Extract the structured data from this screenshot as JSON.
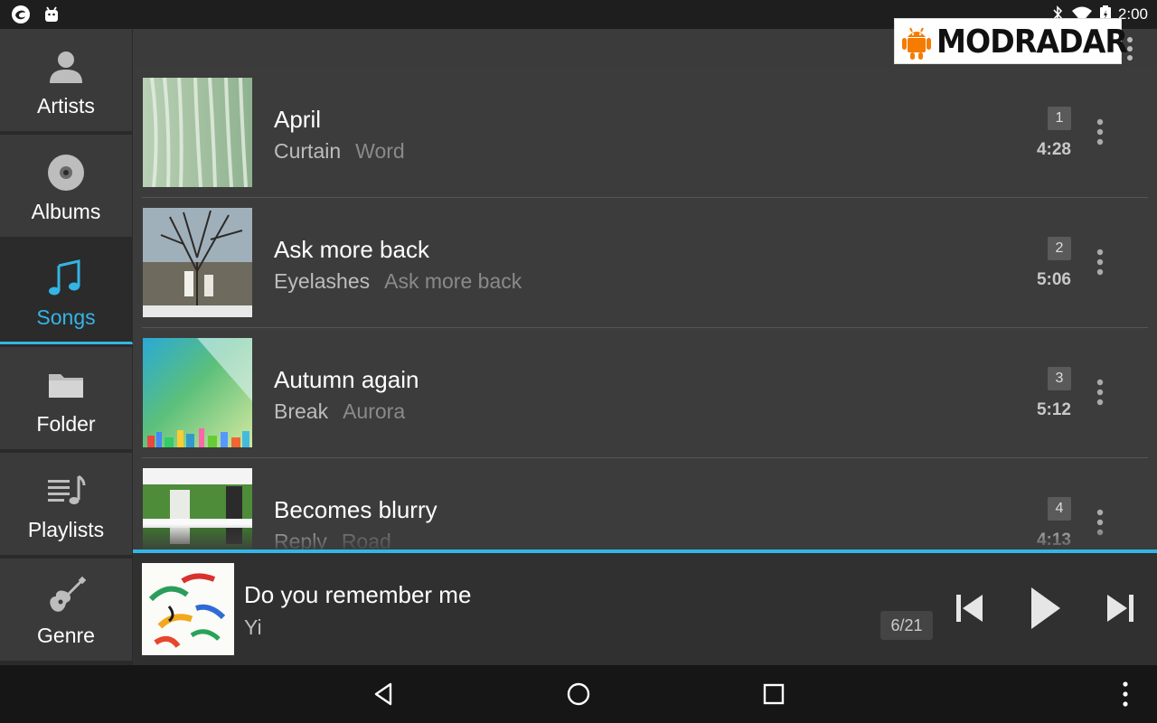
{
  "status_bar": {
    "time": "2:00",
    "left_icons": [
      "swirl-notification-icon",
      "android-notification-icon"
    ],
    "right_icons": [
      "bluetooth-icon",
      "wifi-icon",
      "battery-icon"
    ]
  },
  "watermark": {
    "text": "MODRADAR"
  },
  "sidebar": {
    "accent_color": "#33b5e5",
    "items": [
      {
        "label": "Artists",
        "icon": "person-icon",
        "active": false
      },
      {
        "label": "Albums",
        "icon": "disc-icon",
        "active": false
      },
      {
        "label": "Songs",
        "icon": "music-note-icon",
        "active": true
      },
      {
        "label": "Folder",
        "icon": "folder-icon",
        "active": false
      },
      {
        "label": "Playlists",
        "icon": "playlist-icon",
        "active": false
      },
      {
        "label": "Genre",
        "icon": "guitar-icon",
        "active": false
      }
    ]
  },
  "songs": [
    {
      "title": "April",
      "artist": "Curtain",
      "album": "Word",
      "track": "1",
      "duration": "4:28"
    },
    {
      "title": "Ask more back",
      "artist": "Eyelashes",
      "album": "Ask more back",
      "track": "2",
      "duration": "5:06"
    },
    {
      "title": "Autumn again",
      "artist": "Break",
      "album": "Aurora",
      "track": "3",
      "duration": "5:12"
    },
    {
      "title": "Becomes blurry",
      "artist": "Reply",
      "album": "Road",
      "track": "4",
      "duration": "4:13"
    }
  ],
  "now_playing": {
    "title": "Do you remember me",
    "artist": "Yi",
    "position": "6/21"
  }
}
